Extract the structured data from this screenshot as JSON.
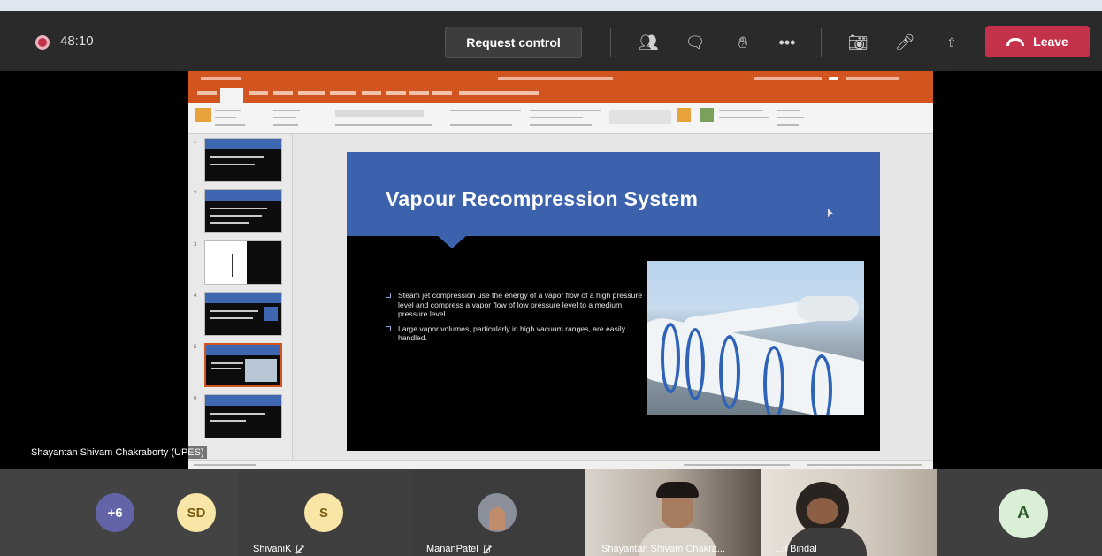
{
  "toolbar": {
    "timer": "48:10",
    "request_control_label": "Request control",
    "leave_label": "Leave"
  },
  "slide": {
    "title": "Vapour Recompression System",
    "bullets": [
      "Steam jet compression use the energy of a vapor flow of a high pressure level and compress a vapor flow of low pressure level to a medium pressure level.",
      "Large vapor volumes, particularly in high vacuum ranges, are easily handled."
    ]
  },
  "stage": {
    "presenter_label": "Shayantan Shivam Chakraborty (UPES)"
  },
  "gallery": {
    "overflow_count": "+6",
    "participants": [
      {
        "initials": "SD",
        "name": ""
      },
      {
        "initials": "S",
        "name": "ShivaniK"
      },
      {
        "initials": "",
        "name": "MananPatel"
      },
      {
        "initials": "",
        "name": "Shayantan Shivam Chakra..."
      },
      {
        "initials": "",
        "name": "...il Bindal"
      },
      {
        "initials": "A",
        "name": ""
      }
    ]
  },
  "colors": {
    "leave": "#c4314b",
    "ppt_accent": "#d2541f",
    "slide_header": "#3d62ad",
    "overflow_avatar": "#6264a7",
    "initials_avatar": "#f8e6a6",
    "a_avatar": "#d9efd6"
  }
}
